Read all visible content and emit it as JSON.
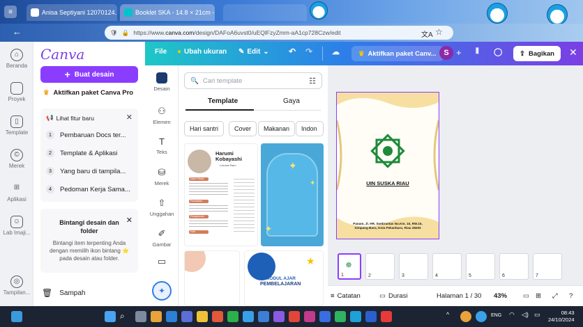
{
  "browser": {
    "tabs": [
      {
        "label": "Anisa Septiyani 12070124..."
      },
      {
        "label": "Booklet SKA - 14.8 × 21cm - C..."
      },
      {
        "label": ""
      }
    ],
    "url_prefix": "https://www.",
    "url_domain": "canva.com",
    "url_path": "/design/DAFoA6uvst0/uEQlFzyZmm-aA1cp728Czw/edit"
  },
  "rail": {
    "items": [
      {
        "label": "Beranda",
        "icon": "home-icon"
      },
      {
        "label": "Proyek",
        "icon": "folder-icon"
      },
      {
        "label": "Template",
        "icon": "template-icon"
      },
      {
        "label": "Merek",
        "icon": "brand-icon"
      },
      {
        "label": "Aplikasi",
        "icon": "apps-icon"
      },
      {
        "label": "Lab Imaji...",
        "icon": "lab-icon"
      },
      {
        "label": "Tampilan...",
        "icon": "display-icon"
      }
    ]
  },
  "sidepanel": {
    "logo": "Canva",
    "create_label": "Buat desain",
    "activate_pro": "Aktifkan paket Canva Pro",
    "features_title": "Lihat fitur baru",
    "features": [
      {
        "num": "1",
        "label": "Pembaruan Docs ter..."
      },
      {
        "num": "2",
        "label": "Template & Aplikasi"
      },
      {
        "num": "3",
        "label": "Yang baru di tampila..."
      },
      {
        "num": "4",
        "label": "Pedoman Kerja Sama..."
      }
    ],
    "star_card_title": "Bintangi desain dan folder",
    "star_card_desc": "Bintangi item terpenting Anda dengan memilih ikon bintang ⭐ pada desain atau folder.",
    "trash_label": "Sampah"
  },
  "editor_bar": {
    "file": "File",
    "resize": "Ubah ukuran",
    "edit": "Edit",
    "activate": "Aktifkan paket Canv...",
    "avatar_letter": "S",
    "share": "Bagikan"
  },
  "tools": [
    {
      "label": "Desain"
    },
    {
      "label": "Elemen"
    },
    {
      "label": "Teks"
    },
    {
      "label": "Merek"
    },
    {
      "label": "Unggahan"
    },
    {
      "label": "Gambar"
    }
  ],
  "template_panel": {
    "search_placeholder": "Cari template",
    "tab_template": "Template",
    "tab_style": "Gaya",
    "chips": [
      "Hari santri",
      "Cover",
      "Makanan",
      "Indon"
    ],
    "thumb1_name": "Harumi Kobayashi",
    "thumb1_sub": "Lulusan Baru",
    "thumb1_sections": [
      "Data Pribadi",
      "Pendidikan",
      "Pengalaman",
      "Hobi"
    ],
    "thumb4_title": "MODUL AJAR",
    "thumb4_sub": "PEMBELAJARAN"
  },
  "canvas": {
    "title": "UIN SUSKA RIAU",
    "address": "Panam, Jl. HR. Soebrantas No.Km. 15, RW.15, Simpang Baru, Kota Pekanbaru, Riau 28293"
  },
  "page_strip": {
    "pages": [
      "1",
      "2",
      "3",
      "4",
      "5",
      "6",
      "7"
    ]
  },
  "bottom_bar": {
    "notes": "Catatan",
    "duration": "Durasi",
    "page_indicator": "Halaman 1 / 30",
    "zoom": "43%"
  },
  "taskbar": {
    "lang": "ENG",
    "time": "08:43",
    "date": "24/10/2024"
  },
  "colors": {
    "brand_purple": "#8b3dff",
    "header_gradient_start": "#1ec7c7",
    "header_gradient_end": "#7b3fe4",
    "uin_green": "#1e8a3a"
  }
}
